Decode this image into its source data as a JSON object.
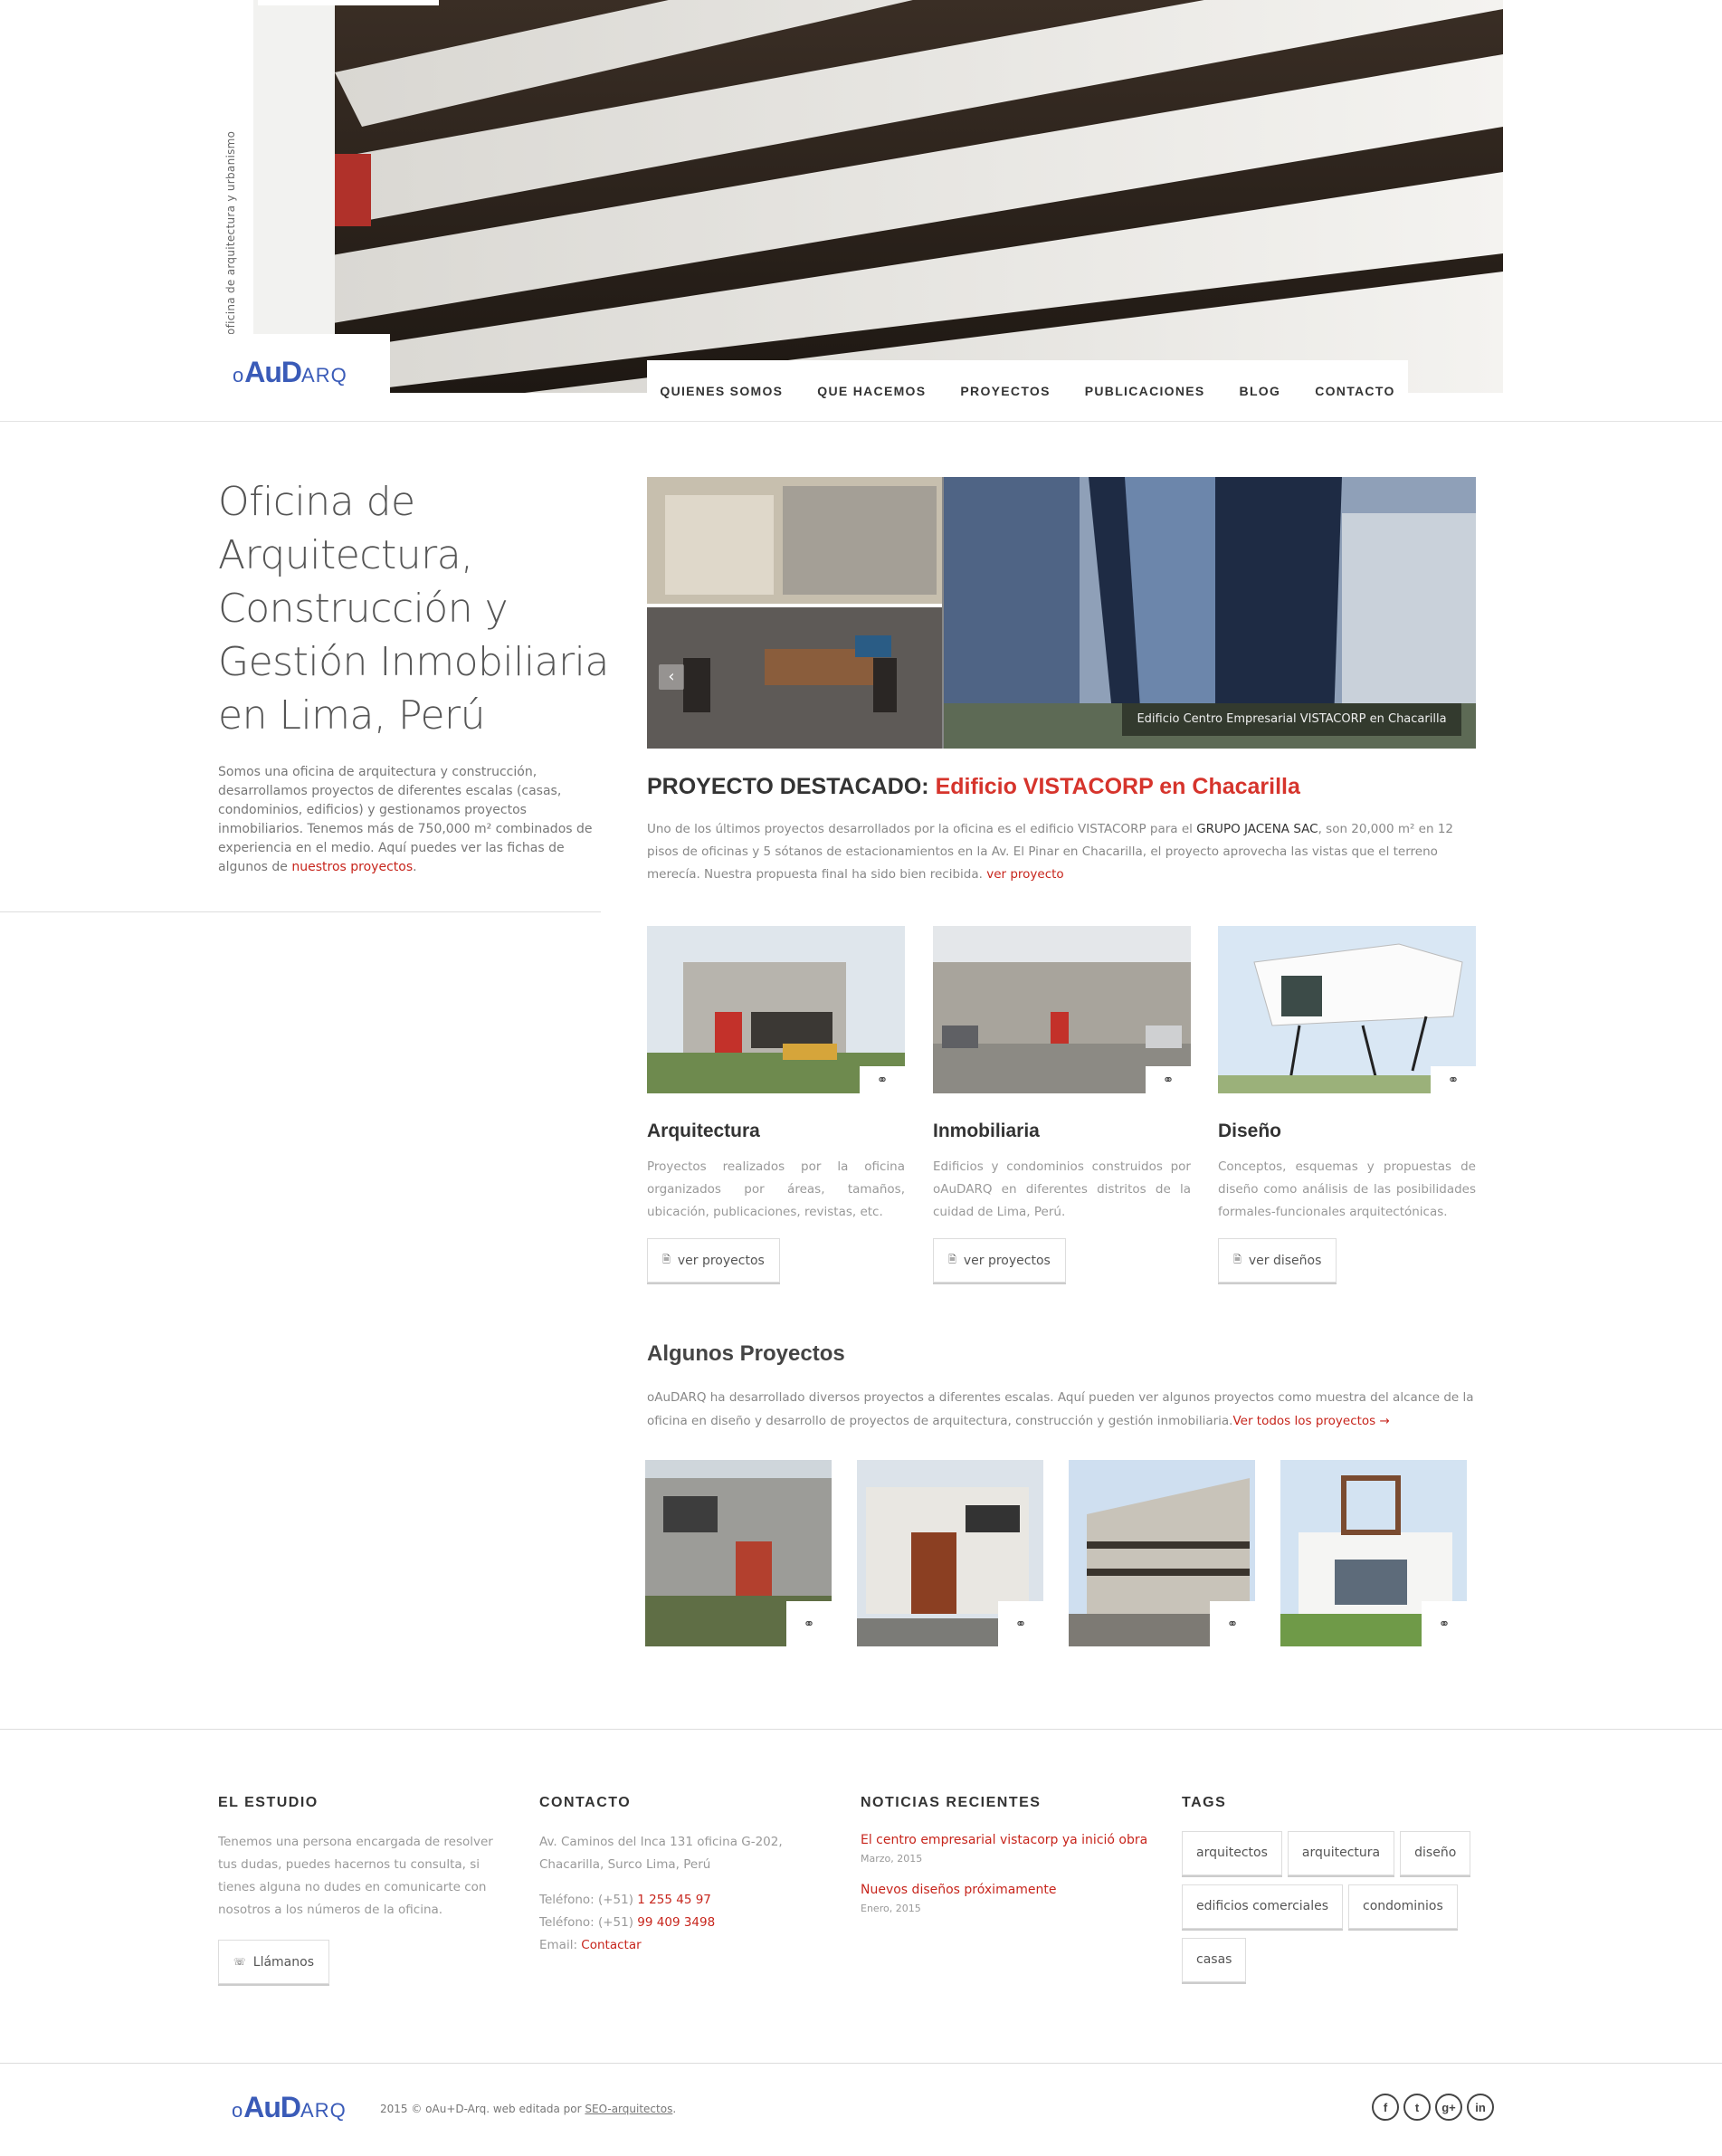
{
  "brand": {
    "logo_prefix": "o",
    "logo_mid": "AuD",
    "logo_suffix": "ARQ",
    "tagline": "oficina de arquitectura y urbanismo"
  },
  "nav": {
    "items": [
      "QUIENES SOMOS",
      "QUE HACEMOS",
      "PROYECTOS",
      "PUBLICACIONES",
      "BLOG",
      "CONTACTO"
    ]
  },
  "intro": {
    "title": "Oficina de Arquitectura, Construcción y Gestión Inmobiliaria en Lima, Perú",
    "text": "Somos una oficina de arquitectura y construcción, desarrollamos proyectos de diferentes escalas (casas, condominios, edificios) y gestionamos proyectos inmobiliarios. Tenemos más de 750,000 m² combinados de experiencia en el medio. Aquí puedes ver las fichas de algunos de ",
    "link": "nuestros proyectos",
    "end": "."
  },
  "slider": {
    "caption": "Edificio Centro Empresarial VISTACORP en Chacarilla",
    "prev_icon": "chevron-left-icon"
  },
  "featured": {
    "label": "PROYECTO DESTACADO:",
    "name": "Edificio VISTACORP en Chacarilla",
    "text_1": "Uno de los últimos proyectos desarrollados por la oficina es el edificio VISTACORP para el ",
    "client": "GRUPO JACENA SAC",
    "text_2": ", son 20,000 m² en 12 pisos de oficinas y 5 sótanos de estacionamientos en la Av. El Pinar en Chacarilla, el proyecto aprovecha las vistas que el terreno merecía. Nuestra propuesta final ha sido bien recibida. ",
    "link": "ver proyecto"
  },
  "services": [
    {
      "title": "Arquitectura",
      "text": "Proyectos realizados por la oficina organizados por áreas, tamaños, ubicación, publicaciones, revistas, etc.",
      "button": "ver proyectos"
    },
    {
      "title": "Inmobiliaria",
      "text": "Edificios y condominios construidos por oAuDARQ en diferentes distritos de la cuidad de Lima, Perú.",
      "button": "ver proyectos"
    },
    {
      "title": "Diseño",
      "text": "Conceptos, esquemas y propuestas de diseño como análisis de las posibilidades formales-funcionales arquitectónicas.",
      "button": "ver diseños"
    }
  ],
  "projects": {
    "title": "Algunos Proyectos",
    "text": "oAuDARQ ha desarrollado diversos proyectos a diferentes escalas. Aquí pueden ver algunos proyectos como muestra del alcance de la oficina en diseño y desarrollo de proyectos de arquitectura, construcción y gestión inmobiliaria.",
    "link": "Ver todos los proyectos →"
  },
  "footer": {
    "studio": {
      "heading": "EL ESTUDIO",
      "text": "Tenemos una persona encargada de resolver tus dudas, puedes hacernos tu consulta, si tienes alguna no dudes en comunicarte con nosotros a los números de la oficina.",
      "button": "Llámanos"
    },
    "contact": {
      "heading": "CONTACTO",
      "address": "Av. Caminos del Inca 131 oficina G-202, Chacarilla, Surco Lima, Perú",
      "phone1_label": "Teléfono: (+51) ",
      "phone1": "1 255 45 97",
      "phone2_label": "Teléfono: (+51) ",
      "phone2": "99 409 3498",
      "email_label": "Email: ",
      "email": "Contactar"
    },
    "news": {
      "heading": "NOTICIAS RECIENTES",
      "items": [
        {
          "title": "El centro empresarial vistacorp ya inició obra",
          "date": "Marzo, 2015"
        },
        {
          "title": "Nuevos diseños próximamente",
          "date": "Enero, 2015"
        }
      ]
    },
    "tags": {
      "heading": "TAGS",
      "items": [
        "arquitectos",
        "arquitectura",
        "diseño",
        "edificios comerciales",
        "condominios",
        "casas"
      ]
    }
  },
  "bottom": {
    "copyright": "2015 © oAu+D-Arq. web editada por ",
    "credit": "SEO-arquitectos",
    "credit_end": ".",
    "social": [
      "f",
      "t",
      "g+",
      "in"
    ]
  },
  "colors": {
    "accent": "#c7251c",
    "logo": "#3a5bb8"
  }
}
